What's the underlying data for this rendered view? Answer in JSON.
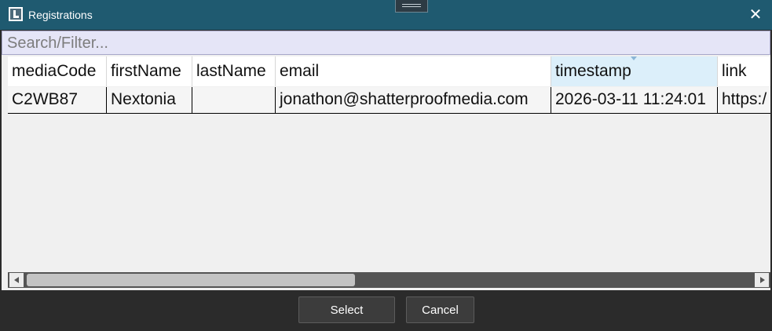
{
  "window": {
    "title": "Registrations"
  },
  "search": {
    "placeholder": "Search/Filter..."
  },
  "table": {
    "columns": [
      "mediaCode",
      "firstName",
      "lastName",
      "email",
      "timestamp",
      "link"
    ],
    "rows": [
      [
        "C2WB87",
        "Nextonia",
        "",
        "jonathon@shatterproofmedia.com",
        "2026-03-11 11:24:01",
        "https:/"
      ]
    ],
    "sorted_column": "timestamp"
  },
  "buttons": {
    "select": "Select",
    "cancel": "Cancel"
  },
  "icons": [
    "app-icon",
    "grip-icon",
    "close-icon",
    "scroll-left-icon",
    "scroll-right-icon"
  ]
}
